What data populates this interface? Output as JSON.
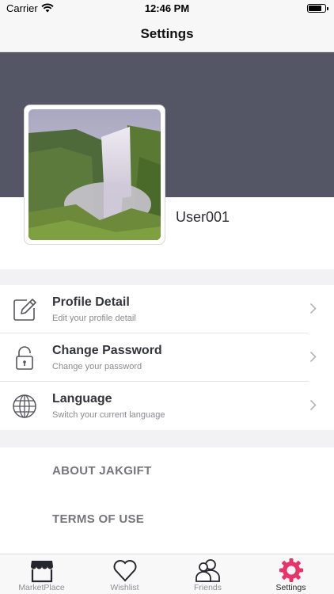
{
  "status_bar": {
    "carrier": "Carrier",
    "time": "12:46 PM"
  },
  "nav": {
    "title": "Settings"
  },
  "profile": {
    "username": "User001"
  },
  "menu": [
    {
      "title": "Profile Detail",
      "subtitle": "Edit your profile detail",
      "icon": "edit-icon"
    },
    {
      "title": "Change Password",
      "subtitle": "Change your password",
      "icon": "lock-icon"
    },
    {
      "title": "Language",
      "subtitle": "Switch your current language",
      "icon": "globe-icon"
    }
  ],
  "links": {
    "about": "ABOUT JAKGIFT",
    "terms": "TERMS OF USE"
  },
  "tabs": [
    {
      "label": "MarketPlace",
      "icon": "store-icon"
    },
    {
      "label": "Wishlist",
      "icon": "heart-icon"
    },
    {
      "label": "Friends",
      "icon": "friends-icon"
    },
    {
      "label": "Settings",
      "icon": "gear-icon"
    }
  ],
  "colors": {
    "header": "#555665",
    "accent": "#e8336a",
    "tab_inactive": "#8e8e93"
  }
}
